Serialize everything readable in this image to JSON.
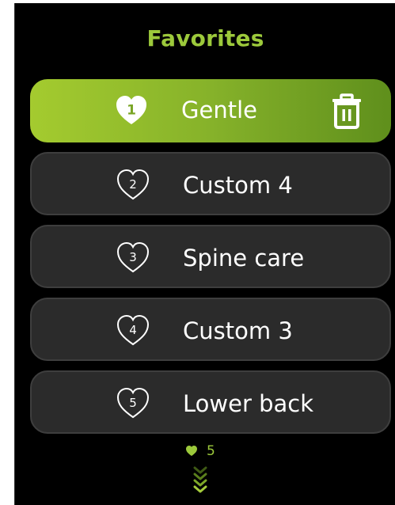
{
  "header": {
    "title": "Favorites"
  },
  "favorites": [
    {
      "number": "1",
      "label": "Gentle",
      "selected": true
    },
    {
      "number": "2",
      "label": "Custom 4",
      "selected": false
    },
    {
      "number": "3",
      "label": "Spine care",
      "selected": false
    },
    {
      "number": "4",
      "label": "Custom 3",
      "selected": false
    },
    {
      "number": "5",
      "label": "Lower back",
      "selected": false
    }
  ],
  "actions": {
    "delete_icon": "trash-icon"
  },
  "pager": {
    "icon": "heart-icon",
    "count": "5",
    "scroll_icon": "chevrons-down-icon"
  },
  "colors": {
    "accent": "#9cc93b",
    "selected_gradient_start": "#a4cb2f",
    "selected_gradient_end": "#5f8f1c",
    "item_background": "#2b2b2b",
    "item_border": "#3e3e3e",
    "screen_background": "#000000"
  }
}
